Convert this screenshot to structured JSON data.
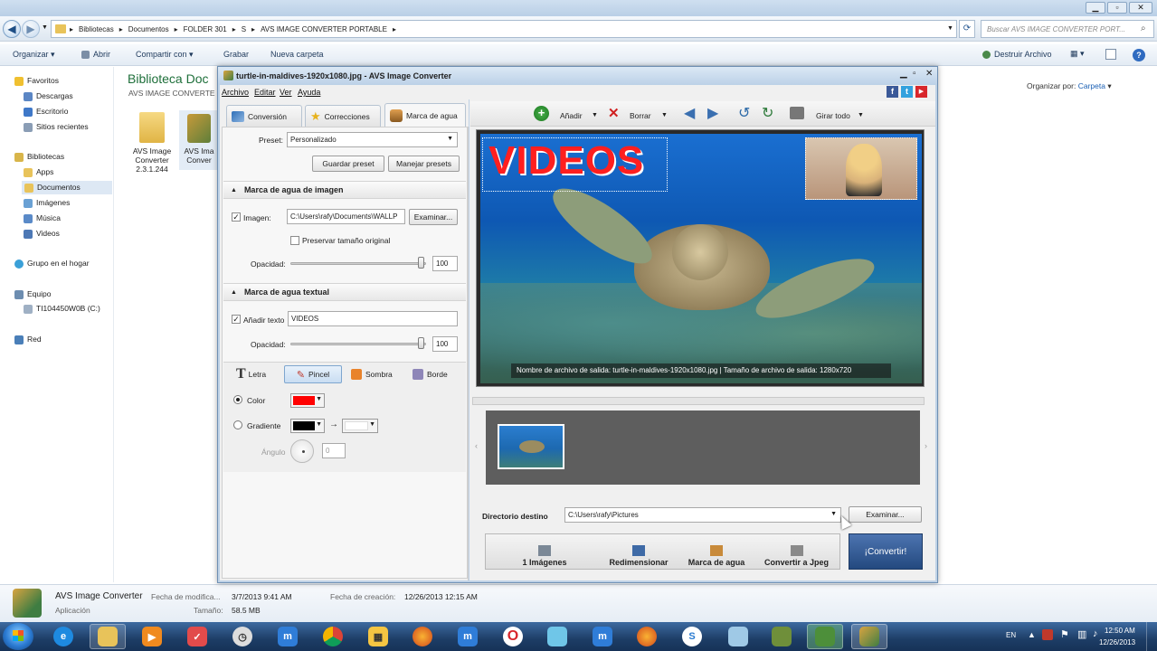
{
  "explorer": {
    "breadcrumb": [
      "Bibliotecas",
      "Documentos",
      "FOLDER 301",
      "S",
      "AVS IMAGE CONVERTER PORTABLE"
    ],
    "search_placeholder": "Buscar AVS IMAGE CONVERTER PORT...",
    "commands": {
      "organize": "Organizar",
      "open": "Abrir",
      "share": "Compartir con",
      "burn": "Grabar",
      "new_folder": "Nueva carpeta",
      "uninstall": "Destruir Archivo"
    },
    "library_title": "Biblioteca Doc",
    "library_subtitle": "AVS IMAGE CONVERTE",
    "arrange_label": "Organizar por:",
    "arrange_value": "Carpeta",
    "nav": {
      "favorites": "Favoritos",
      "downloads": "Descargas",
      "desktop": "Escritorio",
      "recent": "Sitios recientes",
      "libraries": "Bibliotecas",
      "apps": "Apps",
      "documents": "Documentos",
      "images": "Imágenes",
      "music": "Música",
      "videos": "Videos",
      "homegroup": "Grupo en el hogar",
      "computer": "Equipo",
      "drive": "TI104450W0B (C:)",
      "network": "Red"
    },
    "files": [
      {
        "line1": "AVS Image",
        "line2": "Converter",
        "line3": "2.3.1.244"
      },
      {
        "line1": "AVS Ima",
        "line2": "Conver",
        "line3": ""
      }
    ],
    "details": {
      "name": "AVS Image Converter",
      "type": "Aplicación",
      "modified_label": "Fecha de modifica...",
      "modified_value": "3/7/2013 9:41 AM",
      "size_label": "Tamaño:",
      "size_value": "58.5 MB",
      "created_label": "Fecha de creación:",
      "created_value": "12/26/2013 12:15 AM"
    }
  },
  "app": {
    "title": "turtle-in-maldives-1920x1080.jpg - AVS Image Converter",
    "menu": [
      "Archivo",
      "Editar",
      "Ver",
      "Ayuda"
    ],
    "tabs": [
      "Conversión",
      "Correcciones",
      "Marca de agua"
    ],
    "preset_label": "Preset:",
    "preset_value": "Personalizado",
    "save_preset": "Guardar preset",
    "manage_presets": "Manejar presets",
    "image_wm_header": "Marca de agua de imagen",
    "image_label": "Imagen:",
    "image_path": "C:\\Users\\rafy\\Documents\\WALLP",
    "browse": "Examinar...",
    "keep_size": "Preservar tamaño original",
    "opacity_label": "Opacidad:",
    "image_opacity": "100",
    "text_wm_header": "Marca de agua textual",
    "add_text_label": "Añadir texto",
    "text_value": "VIDEOS",
    "text_opacity": "100",
    "style_tabs": [
      "Letra",
      "Pincel",
      "Sombra",
      "Borde"
    ],
    "color_label": "Color",
    "gradient_label": "Gradiente",
    "angle_label": "Ángulo",
    "angle_value": "0",
    "color_value": "#ff0000",
    "toolbar": {
      "add": "Añadir",
      "delete": "Borrar",
      "rotate_all": "Girar todo"
    },
    "watermark_text": "VIDEOS",
    "output_info": "Nombre de archivo de salida: turtle-in-maldives-1920x1080.jpg | Tamaño de archivo de salida: 1280x720",
    "dest_label": "Directorio destino",
    "dest_path": "C:\\Users\\rafy\\Pictures",
    "dest_browse": "Examinar...",
    "steps": [
      "1 Imágenes",
      "Redimensionar",
      "Marca de agua",
      "Convertir a Jpeg"
    ],
    "convert": "¡Convertir!"
  },
  "tray": {
    "lang": "EN",
    "time": "12:50 AM",
    "date": "12/26/2013"
  }
}
